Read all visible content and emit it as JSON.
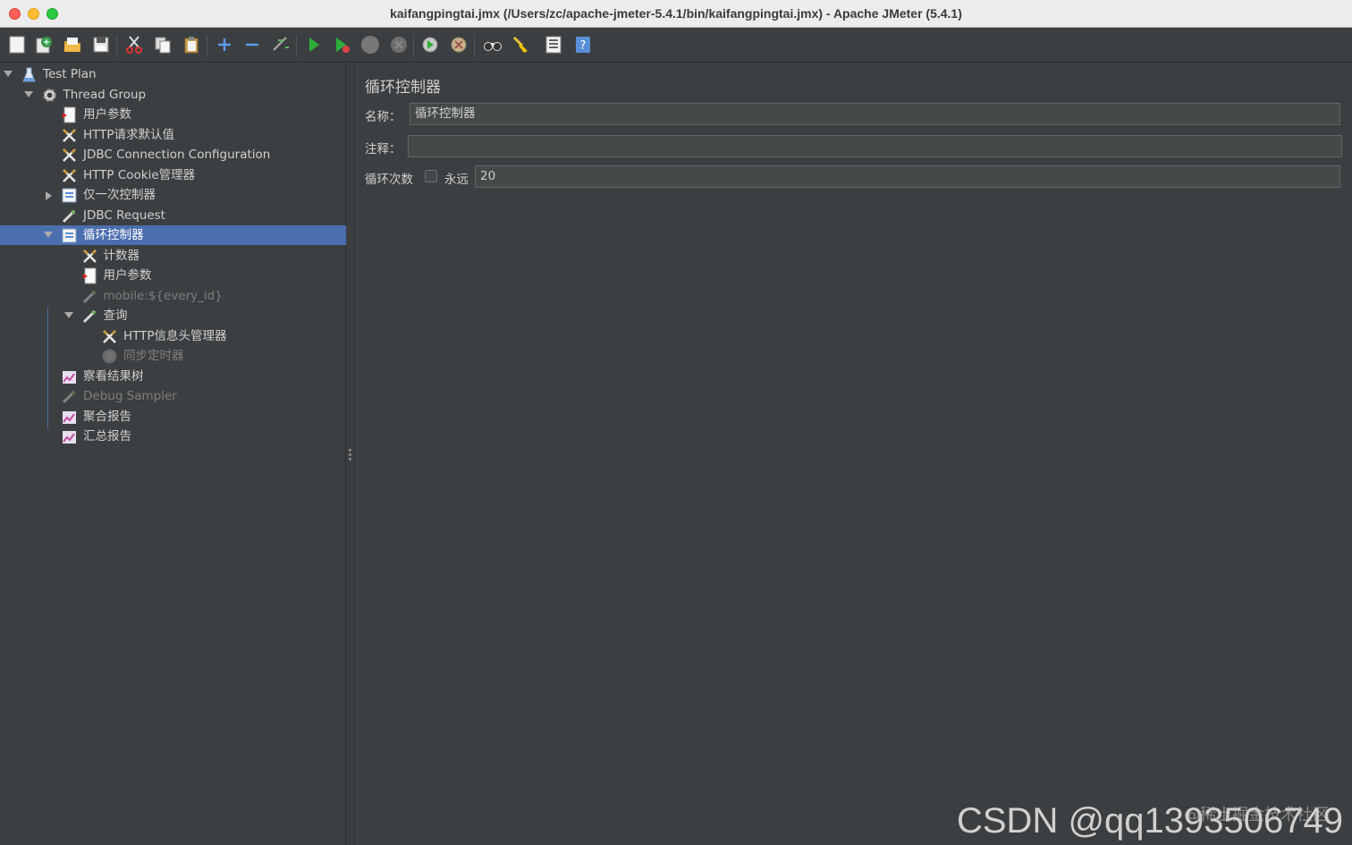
{
  "window": {
    "title": "kaifangpingtai.jmx (/Users/zc/apache-jmeter-5.4.1/bin/kaifangpingtai.jmx) - Apache JMeter (5.4.1)"
  },
  "toolbar": {
    "items": [
      "new-icon",
      "templates-icon",
      "open-icon",
      "save-icon",
      "cut-icon",
      "copy-icon",
      "paste-icon",
      "expand-icon",
      "collapse-icon",
      "toggle-icon",
      "start-icon",
      "start-no-pause-icon",
      "stop-icon",
      "shutdown-icon",
      "remote-start-icon",
      "remote-stop-icon",
      "search-icon",
      "clear-all-icon",
      "function-helper-icon",
      "help-icon"
    ]
  },
  "tree": {
    "items": [
      {
        "label": "Test Plan",
        "icon": "test-plan-icon",
        "expanded": true,
        "disabled": false
      },
      {
        "label": "Thread Group",
        "icon": "thread-group-icon",
        "expanded": true,
        "disabled": false
      },
      {
        "label": "用户参数",
        "icon": "user-params-icon",
        "disabled": false
      },
      {
        "label": "HTTP请求默认值",
        "icon": "config-element-icon",
        "disabled": false
      },
      {
        "label": "JDBC Connection Configuration",
        "icon": "config-element-icon",
        "disabled": false
      },
      {
        "label": "HTTP Cookie管理器",
        "icon": "config-element-icon",
        "disabled": false
      },
      {
        "label": "仅一次控制器",
        "icon": "controller-icon",
        "expanded": false,
        "disabled": false
      },
      {
        "label": "JDBC Request",
        "icon": "sampler-icon",
        "disabled": false
      },
      {
        "label": "循环控制器",
        "icon": "controller-icon",
        "expanded": true,
        "selected": true,
        "disabled": false
      },
      {
        "label": "计数器",
        "icon": "config-element-icon",
        "disabled": false
      },
      {
        "label": "用户参数",
        "icon": "user-params-icon",
        "disabled": false
      },
      {
        "label": "mobile:${every_id}",
        "icon": "sampler-icon",
        "disabled": true
      },
      {
        "label": "查询",
        "icon": "sampler-icon",
        "expanded": true,
        "disabled": false
      },
      {
        "label": "HTTP信息头管理器",
        "icon": "config-element-icon",
        "disabled": false
      },
      {
        "label": "同步定时器",
        "icon": "timer-icon",
        "disabled": true
      },
      {
        "label": "察看结果树",
        "icon": "listener-icon",
        "disabled": false
      },
      {
        "label": "Debug Sampler",
        "icon": "sampler-icon",
        "disabled": true
      },
      {
        "label": "聚合报告",
        "icon": "listener-icon",
        "disabled": false
      },
      {
        "label": "汇总报告",
        "icon": "listener-icon",
        "disabled": false
      }
    ]
  },
  "panel": {
    "title": "循环控制器",
    "name_label": "名称：",
    "name_value": "循环控制器",
    "comment_label": "注释：",
    "comment_value": "",
    "loop_label": "循环次数",
    "forever_label": "永远",
    "forever_checked": false,
    "loop_value": "20"
  },
  "watermark": {
    "main": "CSDN @qq1393506749",
    "secondary": "@稀土掘金技术社区"
  }
}
